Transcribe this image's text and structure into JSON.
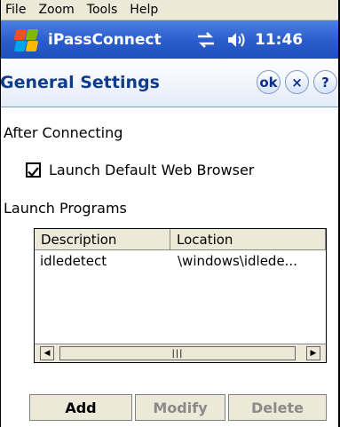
{
  "menubar": {
    "items": [
      {
        "label": "File"
      },
      {
        "label": "Zoom"
      },
      {
        "label": "Tools"
      },
      {
        "label": "Help"
      }
    ]
  },
  "titlebar": {
    "app_name": "iPassConnect",
    "time": "11:46",
    "icons": [
      "windows-start-icon",
      "connectivity-icon",
      "volume-icon"
    ]
  },
  "header": {
    "title": "General Settings",
    "ok_label": "ok",
    "close_label": "×",
    "help_label": "?"
  },
  "after_connecting": {
    "section_label": "After Connecting",
    "launch_browser_label": "Launch Default Web Browser",
    "launch_browser_checked": true
  },
  "launch_programs": {
    "section_label": "Launch Programs",
    "columns": [
      "Description",
      "Location"
    ],
    "rows": [
      {
        "description": "idledetect",
        "location": "\\windows\\idlede..."
      }
    ]
  },
  "buttons": {
    "add": "Add",
    "modify": "Modify",
    "delete": "Delete"
  },
  "colors": {
    "titlebar": "#2a5ccc",
    "header_text": "#103c8f",
    "button_face": "#ece9d8"
  }
}
